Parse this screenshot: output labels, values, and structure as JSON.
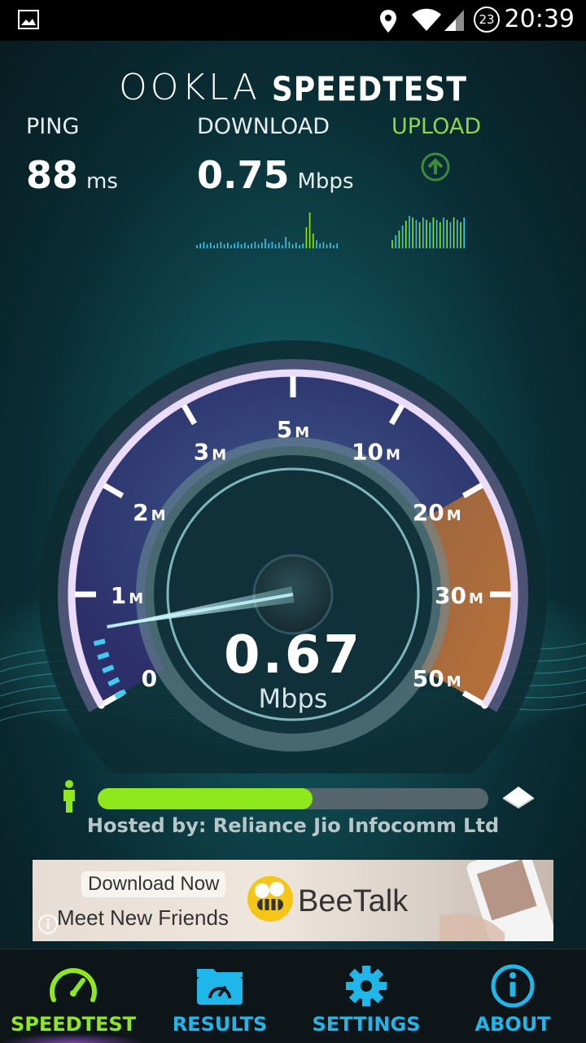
{
  "status_bar": {
    "time": "20:39",
    "notification_badge": "23",
    "icons": [
      "image-icon",
      "location-icon",
      "wifi-icon",
      "signal-icon"
    ]
  },
  "header": {
    "brand_ookla": "OOKLA",
    "brand_speedtest": "SPEEDTEST"
  },
  "stats": {
    "ping_label": "PING",
    "ping_value": "88",
    "ping_unit": "ms",
    "download_label": "DOWNLOAD",
    "download_value": "0.75",
    "download_unit": "Mbps",
    "upload_label": "UPLOAD",
    "upload_color": "#8bd64a"
  },
  "gauge": {
    "ticks": [
      {
        "label": "0",
        "unit": ""
      },
      {
        "label": "1",
        "unit": "M"
      },
      {
        "label": "2",
        "unit": "M"
      },
      {
        "label": "3",
        "unit": "M"
      },
      {
        "label": "5",
        "unit": "M"
      },
      {
        "label": "10",
        "unit": "M"
      },
      {
        "label": "20",
        "unit": "M"
      },
      {
        "label": "30",
        "unit": "M"
      },
      {
        "label": "50",
        "unit": "M"
      }
    ],
    "current_value": "0.67",
    "current_unit": "Mbps",
    "needle_speed_mbps": 0.67,
    "accent_color": "#ffffff",
    "zone_color": "#b8733a"
  },
  "progress": {
    "fraction": 0.55,
    "fill_color": "#8ee81c",
    "hosted_by": "Hosted by: Reliance Jio Infocomm Ltd"
  },
  "ad": {
    "button": "Download Now",
    "tagline": "Meet New Friends",
    "brand": "BeeTalk"
  },
  "nav": {
    "items": [
      {
        "label": "SPEEDTEST",
        "icon": "speedometer-icon",
        "active": true
      },
      {
        "label": "RESULTS",
        "icon": "results-folder-icon",
        "active": false
      },
      {
        "label": "SETTINGS",
        "icon": "gear-icon",
        "active": false
      },
      {
        "label": "ABOUT",
        "icon": "info-icon",
        "active": false
      }
    ],
    "active_color": "#8ee81c",
    "inactive_color": "#1fb7ea"
  }
}
